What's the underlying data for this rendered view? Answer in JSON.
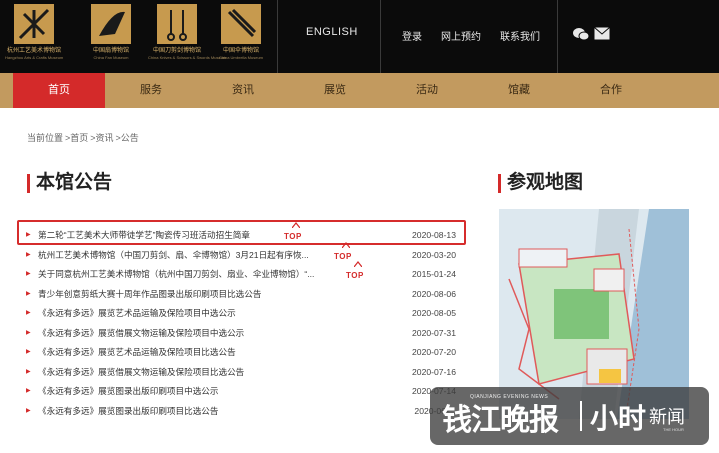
{
  "header": {
    "logos": [
      {
        "name": "杭州工艺美术博物馆",
        "en": "Hangzhou Arts & Crafts Museum"
      },
      {
        "name": "中国扇博物馆",
        "en": "China Fan Museum"
      },
      {
        "name": "中国刀剪剑博物馆",
        "en": "China Knives & Scissors & Swords Museum"
      },
      {
        "name": "中国伞博物馆",
        "en": "China Umbrella Museum"
      }
    ],
    "english": "ENGLISH",
    "login": "登录",
    "booking": "网上预约",
    "contact": "联系我们",
    "icons": [
      "wechat-icon",
      "mail-icon"
    ]
  },
  "nav": [
    "首页",
    "服务",
    "资讯",
    "展览",
    "活动",
    "馆藏",
    "合作"
  ],
  "breadcrumb": [
    "当前位置",
    ">首页",
    ">资讯",
    ">公告"
  ],
  "notice_title": "本馆公告",
  "map_title": "参观地图",
  "top_badge": "TOP",
  "notices": [
    {
      "title": "第二轮“工艺美术大师带徒学艺”陶瓷传习班活动招生简章",
      "date": "2020-08-13"
    },
    {
      "title": "杭州工艺美术博物馆（中国刀剪剑、扇、伞博物馆）3月21日起有序恢...",
      "date": "2020-03-20"
    },
    {
      "title": "关于同意杭州工艺美术博物馆（杭州中国刀剪剑、扇业、伞业博物馆）“...",
      "date": "2015-01-24"
    },
    {
      "title": "青少年创意剪纸大赛十周年作品图录出版印刷项目比选公告",
      "date": "2020-08-06"
    },
    {
      "title": "《永远有多远》展览艺术品运输及保险项目中选公示",
      "date": "2020-08-05"
    },
    {
      "title": "《永远有多远》展览借展文物运输及保险项目中选公示",
      "date": "2020-07-31"
    },
    {
      "title": "《永远有多远》展览艺术品运输及保险项目比选公告",
      "date": "2020-07-20"
    },
    {
      "title": "《永远有多远》展览借展文物运输及保险项目比选公告",
      "date": "2020-07-16"
    },
    {
      "title": "《永远有多远》展览图录出版印刷项目中选公示",
      "date": "2020-07-14"
    },
    {
      "title": "《永远有多远》展览图录出版印刷项目比选公告",
      "date": "2020-06-..."
    }
  ],
  "watermark": {
    "brand": "钱江晚报",
    "pinyin": "QIANJIANG EVENING NEWS",
    "app": "小时",
    "news": "新闻",
    "tag": "THE HOUR"
  },
  "colors": {
    "header_bg": "#0b0b0b",
    "nav_bg": "#c29a5f",
    "accent_red": "#d42a2a",
    "logo_gold": "#c79a4e"
  }
}
